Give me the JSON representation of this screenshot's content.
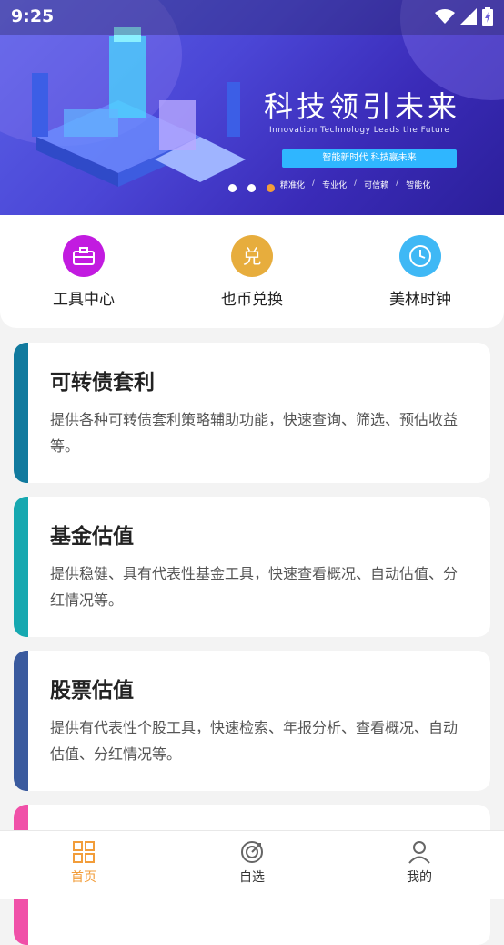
{
  "status_bar": {
    "time": "9:25",
    "icons": [
      "wifi-icon",
      "signal-icon",
      "battery-icon"
    ]
  },
  "banner": {
    "headline": "科技领引未来",
    "subheadline": "Innovation Technology Leads the Future",
    "pill_text": "智能新时代  科技赢未来",
    "tags": [
      "精准化",
      "专业化",
      "可信赖",
      "智能化"
    ],
    "separator": "/",
    "carousel_index": 3,
    "carousel_count": 3
  },
  "quick_menu": [
    {
      "label": "工具中心",
      "icon": "toolbox-icon",
      "color": "#c21be0"
    },
    {
      "label": "也币兑换",
      "icon": "exchange-icon",
      "glyph": "兑",
      "color": "#e7ad3d"
    },
    {
      "label": "美林时钟",
      "icon": "clock-icon",
      "color": "#3fb8f5"
    }
  ],
  "cards": [
    {
      "title": "可转债套利",
      "desc": "提供各种可转债套利策略辅助功能，快速查询、筛选、预估收益等。",
      "accent": "#117a9e"
    },
    {
      "title": "基金估值",
      "desc": "提供稳健、具有代表性基金工具，快速查看概况、自动估值、分红情况等。",
      "accent": "#16a8b0"
    },
    {
      "title": "股票估值",
      "desc": "提供有代表性个股工具，快速检索、年报分析、查看概况、自动估值、分红情况等。",
      "accent": "#3a5a9e"
    },
    {
      "title": "",
      "desc": "",
      "accent": "#f050a8"
    }
  ],
  "bottom_nav": [
    {
      "label": "首页",
      "icon": "home-grid-icon",
      "active": true
    },
    {
      "label": "自选",
      "icon": "target-icon",
      "active": false
    },
    {
      "label": "我的",
      "icon": "user-icon",
      "active": false
    }
  ],
  "colors": {
    "accent": "#f29d3a",
    "background": "#f3f3f3"
  }
}
